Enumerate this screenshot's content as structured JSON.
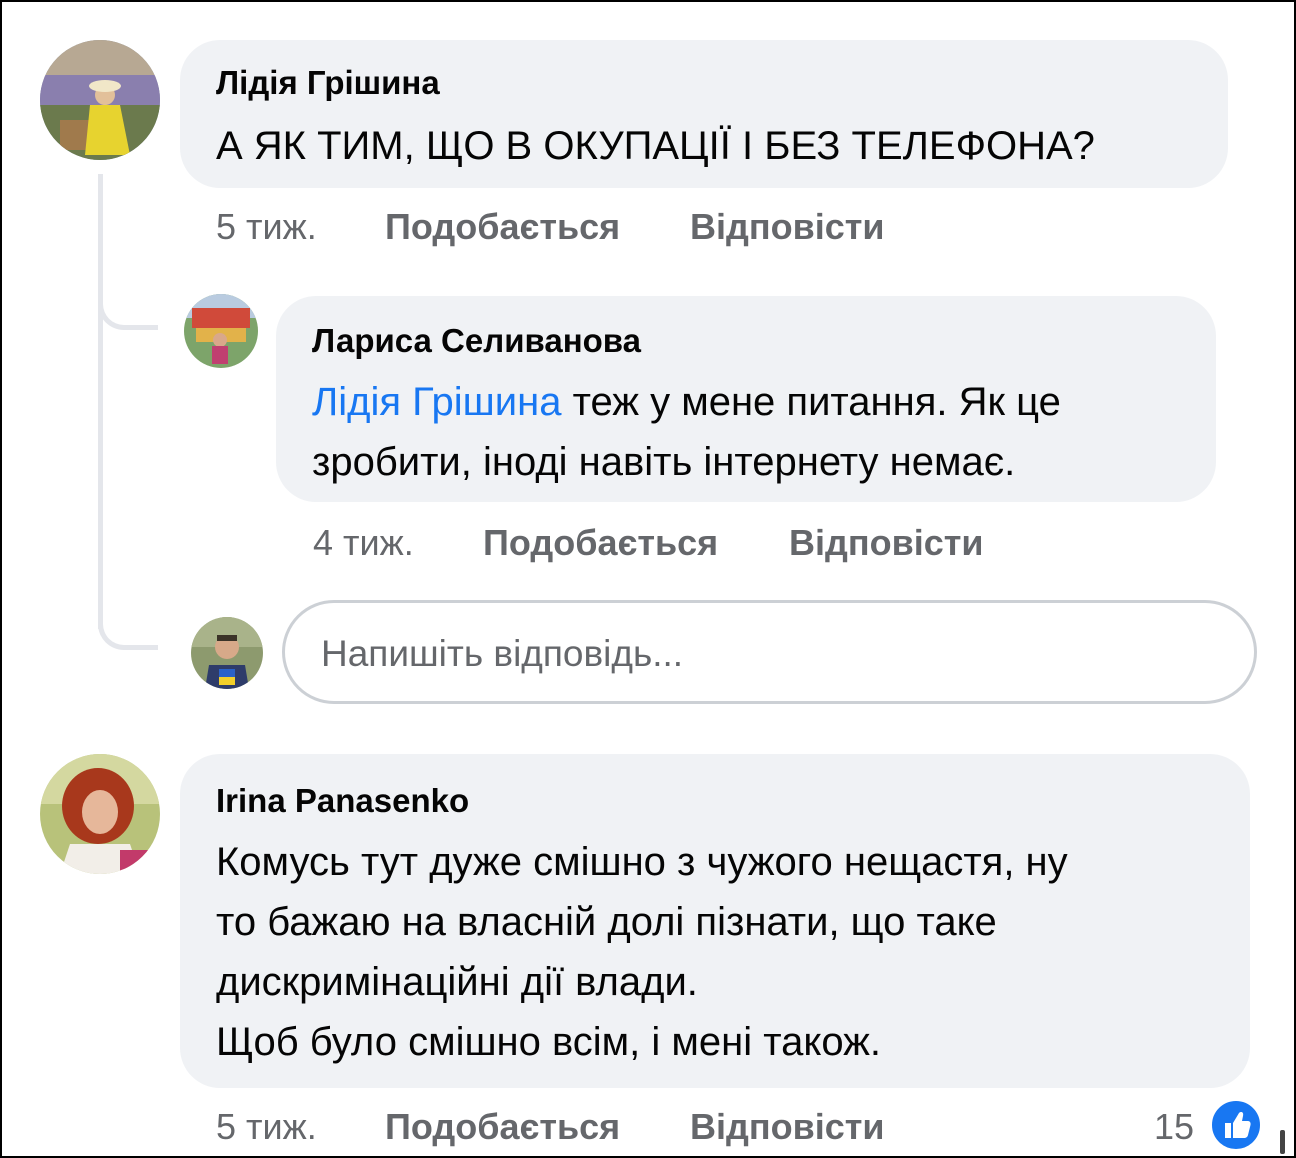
{
  "comments": [
    {
      "author": "Лідія Грішина",
      "text": "А ЯК ТИМ, ЩО В ОКУПАЦІЇ І БЕЗ ТЕЛЕФОНА?",
      "time": "5 тиж.",
      "like_label": "Подобається",
      "reply_label": "Відповісти"
    },
    {
      "author": "Лариса Селиванова",
      "mention": "Лідія Грішина",
      "text_line1_rest": " теж у мене питання. Як це",
      "text_line2": "зробити, іноді навіть інтернету немає.",
      "time": "4 тиж.",
      "like_label": "Подобається",
      "reply_label": "Відповісти"
    },
    {
      "author": "Irina Panasenko",
      "text": "Комусь тут дуже смішно з чужого нещастя, ну\nто бажаю на власній долі пізнати, що таке\nдискримінаційні дії влади.\nЩоб було смішно всім, і мені також.",
      "time": "5 тиж.",
      "like_label": "Подобається",
      "reply_label": "Відповісти",
      "reaction_count": "15"
    }
  ],
  "reply_box": {
    "placeholder": "Напишіть відповідь..."
  },
  "colors": {
    "bubble": "#f0f2f5",
    "mention": "#1877f2",
    "meta": "#65676b",
    "like_badge": "#1877f2"
  },
  "icons": {
    "reaction": "thumbs-up-icon"
  }
}
